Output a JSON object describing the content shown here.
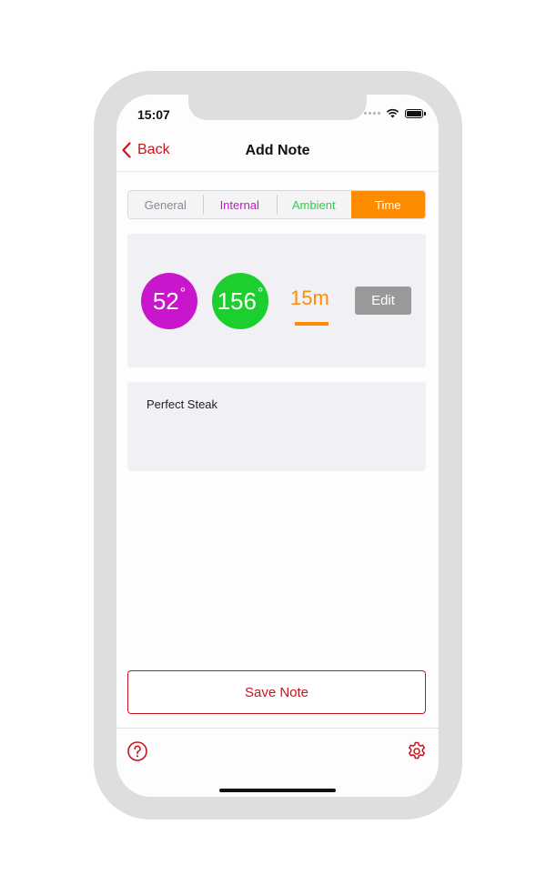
{
  "status": {
    "time": "15:07"
  },
  "nav": {
    "back_label": "Back",
    "title": "Add Note"
  },
  "segments": [
    {
      "label": "General",
      "color": "#8a8a8e",
      "selected": false
    },
    {
      "label": "Internal",
      "color": "#c516c7",
      "selected": false
    },
    {
      "label": "Ambient",
      "color": "#2fcf4a",
      "selected": false
    },
    {
      "label": "Time",
      "color": "#ff8c00",
      "selected": true
    }
  ],
  "readings": {
    "internal": {
      "value": "52",
      "unit": "°",
      "color": "#c916cc"
    },
    "ambient": {
      "value": "156",
      "unit": "°",
      "color": "#1ccf2f"
    },
    "time": {
      "value": "15m",
      "color": "#ff8c00"
    },
    "edit_label": "Edit"
  },
  "note": {
    "text": "Perfect Steak"
  },
  "save_label": "Save Note",
  "colors": {
    "accent": "#c8141c",
    "time": "#ff8c00"
  },
  "icons": {
    "back": "chevron-left-icon",
    "help": "question-circle-icon",
    "settings": "gear-icon"
  }
}
